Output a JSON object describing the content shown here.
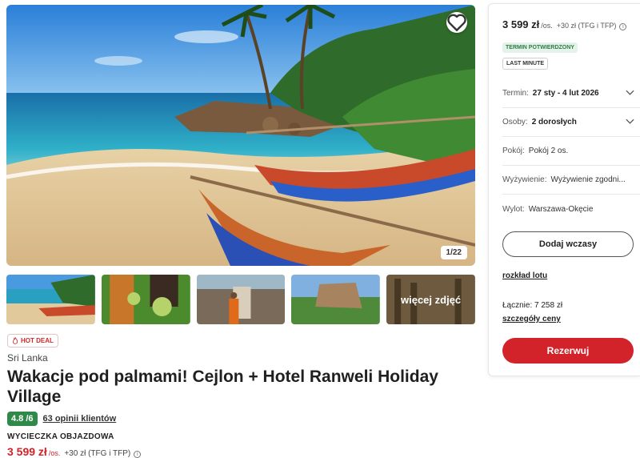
{
  "gallery": {
    "counter": "1/22",
    "more_photos_label": "więcej zdjęć",
    "favorite_icon": "heart-outline-icon"
  },
  "offer": {
    "hot_deal_label": "HOT DEAL",
    "country": "Sri Lanka",
    "title": "Wakacje pod palmami! Cejlon + Hotel Ranweli Holiday Village",
    "rating": "4.8 /6",
    "reviews_link": "63 opinii klientów",
    "trip_type": "WYCIECZKA OBJAZDOWA",
    "price": "3 599 zł",
    "price_unit": "/os.",
    "price_extra": "+30 zł (TFG i TFP)"
  },
  "booking": {
    "price": "3 599 zł",
    "price_unit": "/os.",
    "price_extra": "+30 zł (TFG i TFP)",
    "tag_confirmed": "TERMIN POTWIERDZONY",
    "tag_last_minute": "LAST MINUTE",
    "fields": {
      "term": {
        "label": "Termin:",
        "value": "27 sty - 4 lut 2026"
      },
      "people": {
        "label": "Osoby:",
        "value": "2 dorosłych"
      },
      "room": {
        "label": "Pokój:",
        "value": "Pokój 2 os."
      },
      "board": {
        "label": "Wyżywienie:",
        "value": "Wyżywienie zgodni..."
      },
      "departure": {
        "label": "Wylot:",
        "value": "Warszawa-Okęcie"
      }
    },
    "add_button": "Dodaj wczasy",
    "flight_schedule_link": "rozkład lotu",
    "total": "Łącznie: 7 258 zł",
    "price_details_link": "szczegóły ceny",
    "book_button": "Rezerwuj"
  },
  "colors": {
    "brand_red": "#d2232a",
    "rating_green": "#2f8a4a"
  }
}
